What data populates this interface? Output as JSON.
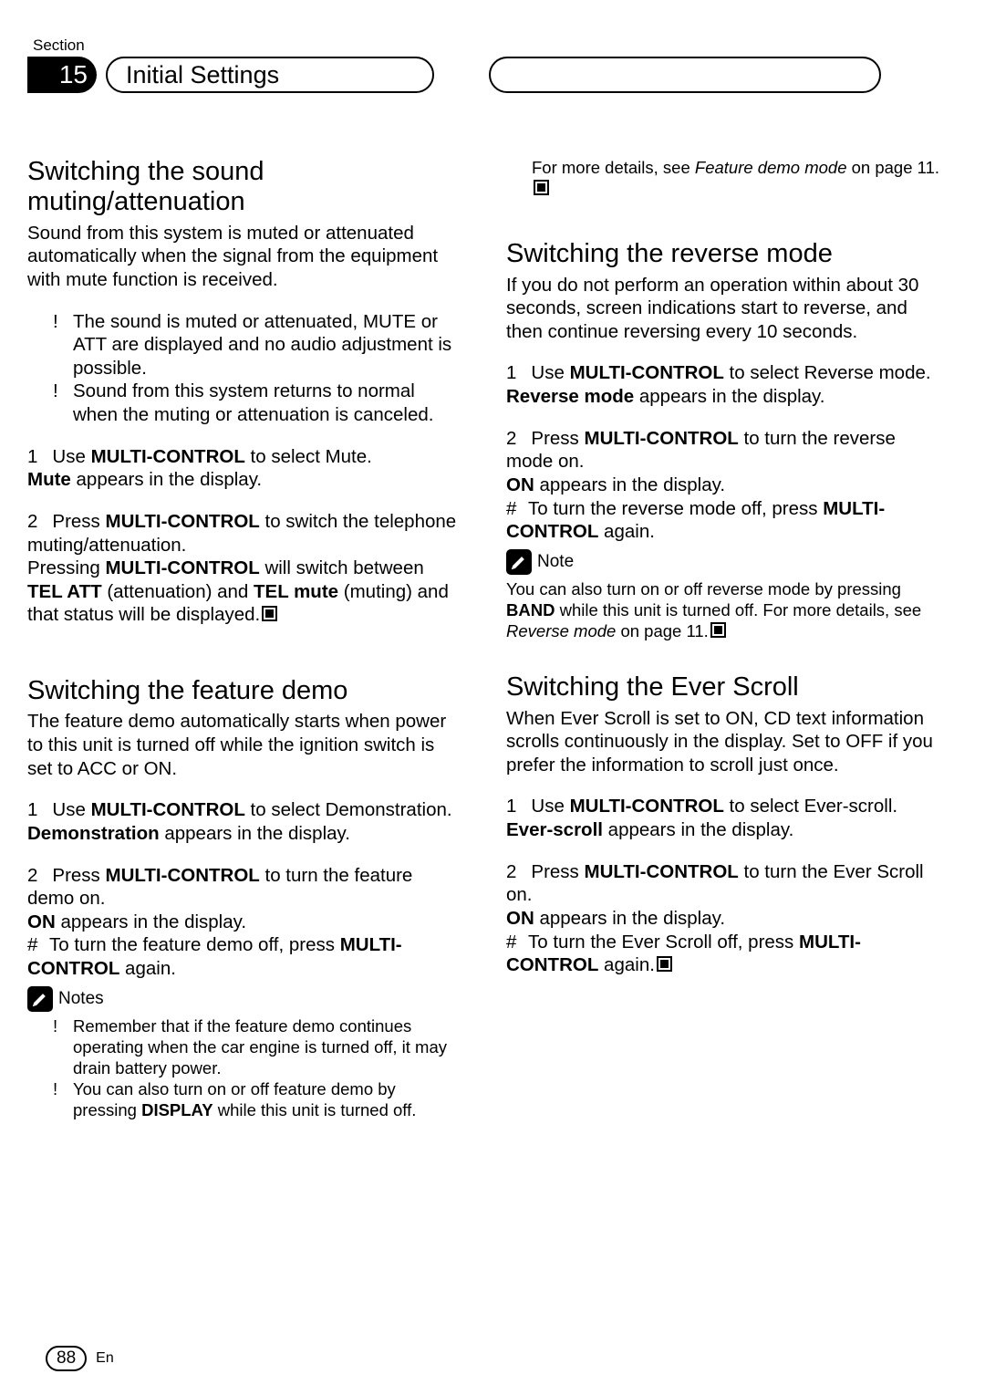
{
  "header": {
    "section_label": "Section",
    "section_number": "15",
    "title": "Initial Settings"
  },
  "left": {
    "s1": {
      "title": "Switching the sound muting/attenuation",
      "intro": "Sound from this system is muted or attenuated automatically when the signal from the equipment with mute function is received.",
      "b1": "The sound is muted or attenuated, MUTE or ATT are displayed and no audio adjustment is possible.",
      "b2": "Sound from this system returns to normal when the muting or attenuation is canceled.",
      "step1_num": "1",
      "step1_a": "Use ",
      "step1_b": "MULTI-CONTROL",
      "step1_c": " to select Mute.",
      "step1_sub_a": "Mute",
      "step1_sub_b": " appears in the display.",
      "step2_num": "2",
      "step2_a": "Press ",
      "step2_b": "MULTI-CONTROL",
      "step2_c": " to switch the telephone muting/attenuation.",
      "step2_sub_a": "Pressing ",
      "step2_sub_b": "MULTI-CONTROL",
      "step2_sub_c": " will switch between ",
      "step2_sub_d": "TEL ATT",
      "step2_sub_e": " (attenuation) and ",
      "step2_sub_f": "TEL mute",
      "step2_sub_g": " (muting) and that status will be displayed."
    },
    "s2": {
      "title": "Switching the feature demo",
      "intro": "The feature demo automatically starts when power to this unit is turned off while the ignition switch is set to ACC or ON.",
      "step1_num": "1",
      "step1_a": "Use ",
      "step1_b": "MULTI-CONTROL",
      "step1_c": " to select Demonstration.",
      "step1_sub_a": "Demonstration",
      "step1_sub_b": " appears in the display.",
      "step2_num": "2",
      "step2_a": "Press ",
      "step2_b": "MULTI-CONTROL",
      "step2_c": " to turn the feature demo on.",
      "step2_sub_a": "ON",
      "step2_sub_b": " appears in the display.",
      "hash": "#",
      "hash_a": "To turn the feature demo off, press ",
      "hash_b": "MULTI-CONTROL",
      "hash_c": " again.",
      "notes_label": "Notes",
      "n1": "Remember that if the feature demo continues operating when the car engine is turned off, it may drain battery power.",
      "n2_a": "You can also turn on or off feature demo by pressing ",
      "n2_b": "DISPLAY",
      "n2_c": " while this unit is turned off."
    }
  },
  "right": {
    "cont_a": "For more details, see ",
    "cont_b": "Feature demo mode",
    "cont_c": " on page 11.",
    "s3": {
      "title": "Switching the reverse mode",
      "intro": "If you do not perform an operation within about 30 seconds, screen indications start to reverse, and then continue reversing every 10 seconds.",
      "step1_num": "1",
      "step1_a": "Use ",
      "step1_b": "MULTI-CONTROL",
      "step1_c": " to select Reverse mode.",
      "step1_sub_a": "Reverse mode",
      "step1_sub_b": " appears in the display.",
      "step2_num": "2",
      "step2_a": "Press ",
      "step2_b": "MULTI-CONTROL",
      "step2_c": " to turn the reverse mode on.",
      "step2_sub_a": "ON",
      "step2_sub_b": " appears in the display.",
      "hash": "#",
      "hash_a": "To turn the reverse mode off, press ",
      "hash_b": "MULTI-CONTROL",
      "hash_c": " again.",
      "note_label": "Note",
      "note_a": "You can also turn on or off reverse mode by pressing ",
      "note_b": "BAND",
      "note_c": " while this unit is turned off. For more details, see ",
      "note_d": "Reverse mode",
      "note_e": " on page 11."
    },
    "s4": {
      "title": "Switching the Ever Scroll",
      "intro": "When Ever Scroll is set to ON, CD text information scrolls continuously in the display. Set to OFF if you prefer the information to scroll just once.",
      "step1_num": "1",
      "step1_a": "Use ",
      "step1_b": "MULTI-CONTROL",
      "step1_c": " to select Ever-scroll.",
      "step1_sub_a": "Ever-scroll",
      "step1_sub_b": " appears in the display.",
      "step2_num": "2",
      "step2_a": "Press ",
      "step2_b": "MULTI-CONTROL",
      "step2_c": " to turn the Ever Scroll on.",
      "step2_sub_a": "ON",
      "step2_sub_b": " appears in the display.",
      "hash": "#",
      "hash_a": "To turn the Ever Scroll off, press ",
      "hash_b": "MULTI-CONTROL",
      "hash_c": " again."
    }
  },
  "footer": {
    "page": "88",
    "lang": "En"
  },
  "marks": {
    "bullet": "!"
  }
}
